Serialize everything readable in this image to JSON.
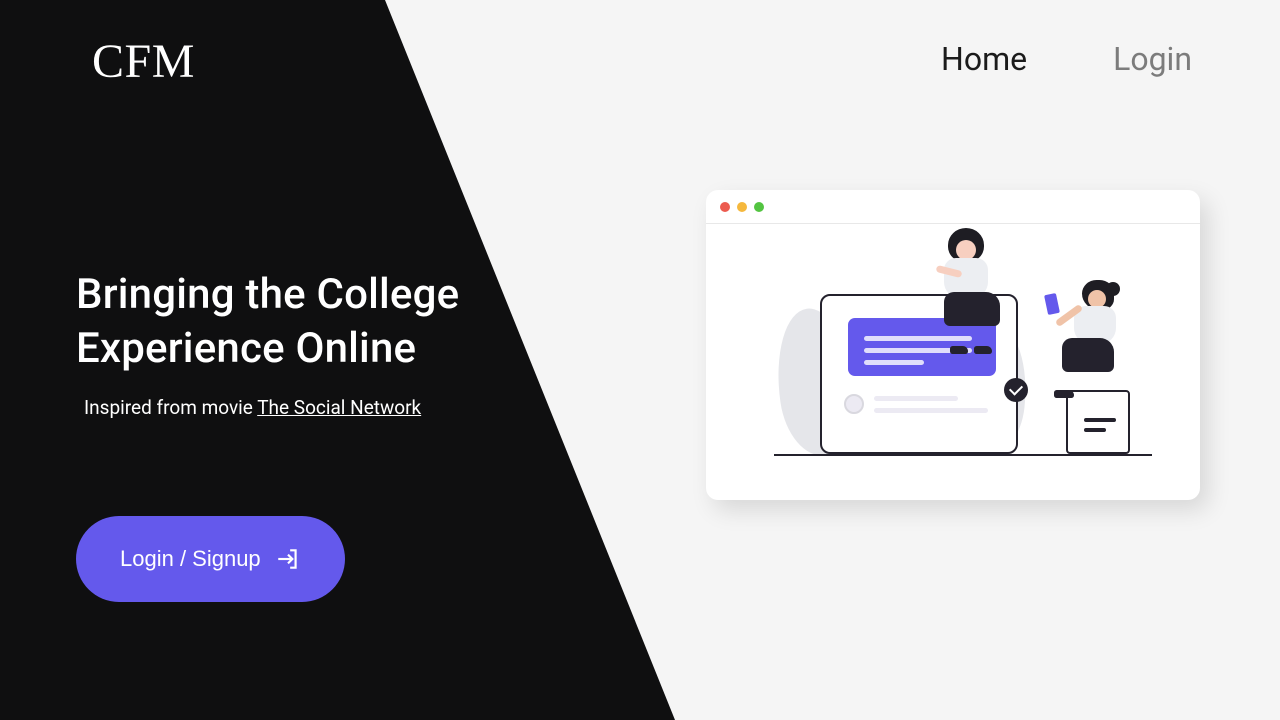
{
  "brand": {
    "name": "CFM"
  },
  "nav": {
    "items": [
      {
        "label": "Home",
        "active": true
      },
      {
        "label": "Login",
        "active": false
      }
    ]
  },
  "hero": {
    "headline_line1": "Bringing the College",
    "headline_line2": "Experience Online",
    "sub_prefix": "Inspired from movie ",
    "sub_link": "The Social Network"
  },
  "cta": {
    "label": "Login / Signup"
  },
  "colors": {
    "accent": "#6459ec",
    "dark": "#0f0f10"
  },
  "illustration": {
    "traffic_dots": [
      "red",
      "yellow",
      "green"
    ]
  }
}
